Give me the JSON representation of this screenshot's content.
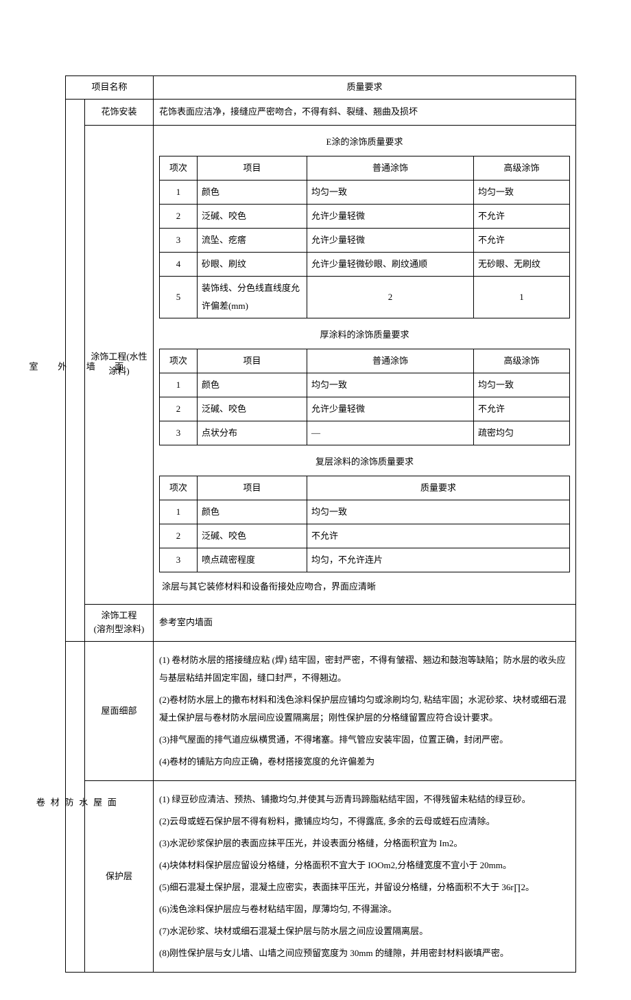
{
  "header": {
    "col1": "项目名称",
    "col2": "质量要求"
  },
  "group1": {
    "vlabel": "室\n\n外\n\n墙\n\n面",
    "row1": {
      "name": "花饰安装",
      "req": "花饰表面应洁净，接缝应严密吻合，不得有斜、裂缝、翘曲及损坏"
    },
    "row2": {
      "name": "涂饰工程(水性涂料)"
    },
    "row3": {
      "name": "涂饰工程\n(溶剂型涂料)",
      "req": "参考室内墙面"
    }
  },
  "t1": {
    "caption": "E涂的涂饰质量要求",
    "h": {
      "c1": "项次",
      "c2": "项目",
      "c3": "普通涂饰",
      "c4": "高级涂饰"
    },
    "rows": [
      {
        "c1": "1",
        "c2": "颜色",
        "c3": "均匀一致",
        "c4": "均匀一致"
      },
      {
        "c1": "2",
        "c2": "泛碱、咬色",
        "c3": "允许少量轻微",
        "c4": "不允许"
      },
      {
        "c1": "3",
        "c2": "流坠、疙瘩",
        "c3": "允许少量轻微",
        "c4": "不允许"
      },
      {
        "c1": "4",
        "c2": "砂眼、刷纹",
        "c3": "允许少量轻微砂眼、刷纹通顺",
        "c4": "无砂眼、无刷纹"
      },
      {
        "c1": "5",
        "c2": "装饰线、分色线直线度允许偏差(mm)",
        "c3": "2",
        "c4": "1"
      }
    ]
  },
  "t2": {
    "caption": "厚涂料的涂饰质量要求",
    "h": {
      "c1": "项次",
      "c2": "项目",
      "c3": "普通涂饰",
      "c4": "高级涂饰"
    },
    "rows": [
      {
        "c1": "1",
        "c2": "颜色",
        "c3": "均匀一致",
        "c4": "均匀一致"
      },
      {
        "c1": "2",
        "c2": "泛碱、咬色",
        "c3": "允许少量轻微",
        "c4": "不允许"
      },
      {
        "c1": "3",
        "c2": "点状分布",
        "c3": "—",
        "c4": "疏密均匀"
      }
    ]
  },
  "t3": {
    "caption": "复层涂料的涂饰质量要求",
    "h": {
      "c1": "项次",
      "c2": "项目",
      "c3": "质量要求"
    },
    "rows": [
      {
        "c1": "1",
        "c2": "颜色",
        "c3": "均匀一致"
      },
      {
        "c1": "2",
        "c2": "泛碱、咬色",
        "c3": "不允许"
      },
      {
        "c1": "3",
        "c2": "喷点疏密程度",
        "c3": "均匀，不允许连片"
      }
    ]
  },
  "coating_note": "涂层与其它装修材料和设备衔接处应吻合，界面应清晰",
  "group2": {
    "vlabel": "卷\n材\n防\n水\n屋\n面",
    "row1": {
      "name": "屋面细部",
      "p1": "(1) 卷材防水层的搭接缝应粘 (焊) 结牢固，密封严密，不得有皱褶、翘边和鼓泡等缺陷；防水层的收头应与基层粘结并固定牢固，缝口封严，不得翘边。",
      "p2": "(2)卷材防水层上的撒布材料和浅色涂料保护层应铺均匀或涂刷均匀, 粘结牢固；水泥砂浆、块材或细石混凝土保护层与卷材防水层间应设置隔离层；刚性保护层的分格缝留置应符合设计要求。",
      "p3": "(3)排气屋面的排气道应纵横贯通，不得堵塞。排气管应安装牢固，位置正确，封闭严密。",
      "p4": "(4)卷材的铺贴方向应正确，卷材搭接宽度的允许偏差为"
    },
    "row2": {
      "name": "保护层",
      "p1": "(1) 绿豆砂应清洁、预热、铺撒均匀,并使其与沥青玛蹄脂粘结牢固，不得残留未粘结的绿豆砂。",
      "p2": "(2)云母或蛭石保护层不得有粉料，撒铺应均匀，不得露底, 多余的云母或蛭石应清除。",
      "p3": "(3)水泥砂浆保护层的表面应抹平压光，并设表面分格缝，分格面积宜为 Im2。",
      "p4": "(4)块体材料保护层应留设分格缝，分格面积不宜大于 IOOm2,分格缝宽度不宜小于 20mm。",
      "p5": "(5)细石混凝土保护层，混凝土应密实，表面抹平压光，并留设分格缝，分格面积不大于 36r∏2。",
      "p6": "(6)浅色涂料保护层应与卷材粘结牢固，厚薄均匀, 不得漏涂。",
      "p7": "(7)水泥砂浆、块材或细石混凝土保护层与防水层之间应设置隔离层。",
      "p8": "(8)刚性保护层与女儿墙、山墙之间应预留宽度为 30mm 的缝隙，并用密封材料嵌填严密。"
    }
  }
}
